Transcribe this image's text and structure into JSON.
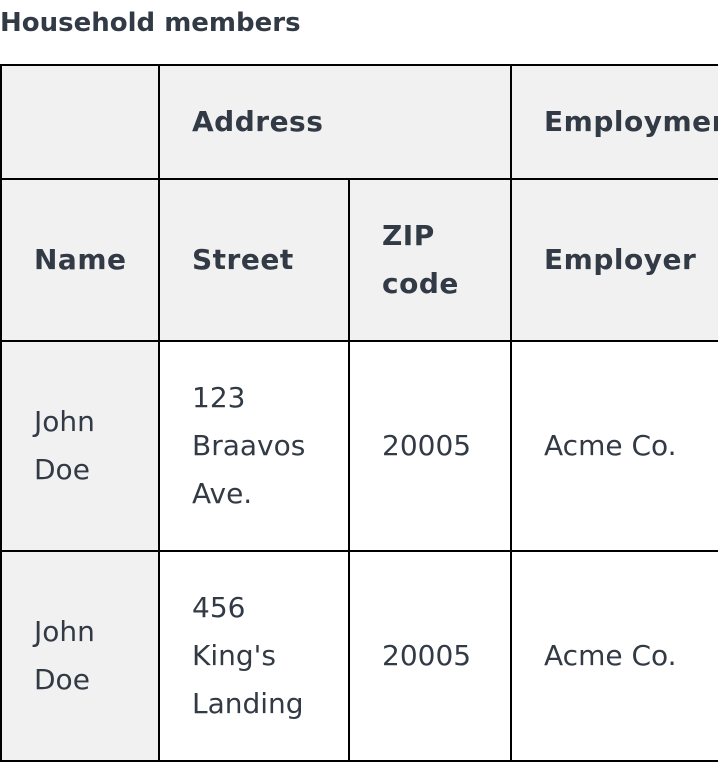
{
  "caption": "Household members",
  "table": {
    "group_headers": {
      "address": "Address",
      "employment": "Employment"
    },
    "column_headers": {
      "name": "Name",
      "street": "Street",
      "zip": "ZIP code",
      "employer": "Employer"
    },
    "rows": [
      {
        "name_line1": "John",
        "name_line2": "Doe",
        "street_line1": "123",
        "street_line2": "Braavos",
        "street_line3": "Ave.",
        "zip": "20005",
        "employer": "Acme Co."
      },
      {
        "name_line1": "John",
        "name_line2": "Doe",
        "street_line1": "456",
        "street_line2": "King's",
        "street_line3": "Landing",
        "zip": "20005",
        "employer": "Acme Co."
      }
    ]
  }
}
